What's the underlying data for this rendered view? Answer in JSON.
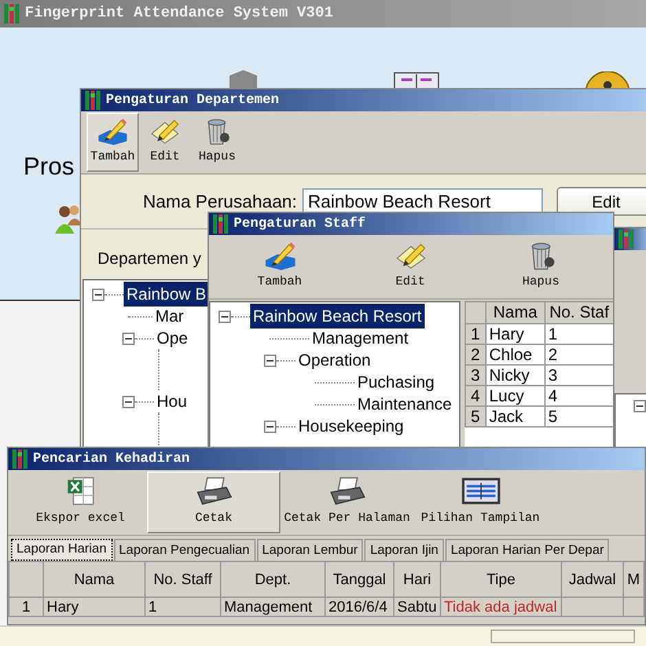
{
  "main_window": {
    "title": "Fingerprint Attendance System V301",
    "heading": "Pros"
  },
  "department_window": {
    "title": "Pengaturan Departemen",
    "toolbar": [
      {
        "label": "Tambah",
        "pressed": true
      },
      {
        "label": "Edit",
        "pressed": false
      },
      {
        "label": "Hapus",
        "pressed": false
      }
    ],
    "company_label": "Nama Perusahaan:",
    "company_value": "Rainbow Beach Resort",
    "edit_button": "Edit",
    "list_label": "Departemen y",
    "tree": [
      {
        "label": "Rainbow B",
        "selected": true,
        "expanded": true,
        "children": [
          {
            "label": "Mar",
            "selected": false
          },
          {
            "label": "Ope",
            "selected": false,
            "expanded": true
          },
          {
            "label": "Hou",
            "selected": false,
            "expanded": true
          }
        ]
      }
    ]
  },
  "staff_window": {
    "title": "Pengaturan Staff",
    "toolbar": [
      {
        "label": "Tambah",
        "pressed": false
      },
      {
        "label": "Edit",
        "pressed": false
      },
      {
        "label": "Hapus",
        "pressed": false
      }
    ],
    "tree": [
      {
        "label": "Rainbow Beach Resort",
        "selected": true,
        "expanded": true,
        "children": [
          {
            "label": "Management",
            "selected": false
          },
          {
            "label": "Operation",
            "selected": false,
            "expanded": true,
            "children": [
              {
                "label": "Puchasing",
                "selected": false
              },
              {
                "label": "Maintenance",
                "selected": false
              }
            ]
          },
          {
            "label": "Housekeeping",
            "selected": false,
            "expanded": true
          }
        ]
      }
    ],
    "table": {
      "columns": [
        "Nama",
        "No. Staf"
      ],
      "rows": [
        {
          "number": "1",
          "cells": [
            "Hary",
            "1"
          ]
        },
        {
          "number": "2",
          "cells": [
            "Chloe",
            "2"
          ]
        },
        {
          "number": "3",
          "cells": [
            "Nicky",
            "3"
          ]
        },
        {
          "number": "4",
          "cells": [
            "Lucy",
            "4"
          ]
        },
        {
          "number": "5",
          "cells": [
            "Jack",
            "5"
          ]
        }
      ]
    }
  },
  "attendance_window": {
    "title": "Pencarian Kehadiran",
    "toolbar": [
      {
        "label": "Ekspor excel",
        "pressed": false
      },
      {
        "label": "Cetak",
        "pressed": true
      },
      {
        "label": "Cetak Per Halaman",
        "pressed": false
      },
      {
        "label": "Pilihan Tampilan",
        "pressed": false
      }
    ],
    "tabs": [
      {
        "label": "Laporan Harian",
        "selected": true
      },
      {
        "label": "Laporan Pengecualian",
        "selected": false
      },
      {
        "label": "Laporan Lembur",
        "selected": false
      },
      {
        "label": "Laporan Ijin",
        "selected": false
      },
      {
        "label": "Laporan Harian Per Depar",
        "selected": false
      }
    ],
    "table": {
      "columns": [
        "Nama",
        "No. Staff",
        "Dept.",
        "Tanggal",
        "Hari",
        "Tipe",
        "Jadwal",
        "M"
      ],
      "rows": [
        {
          "number": "1",
          "cells": [
            "Hary",
            "1",
            "Management",
            "2016/6/4",
            "Sabtu",
            "Tidak ada jadwal"
          ],
          "warning": true
        }
      ]
    }
  }
}
